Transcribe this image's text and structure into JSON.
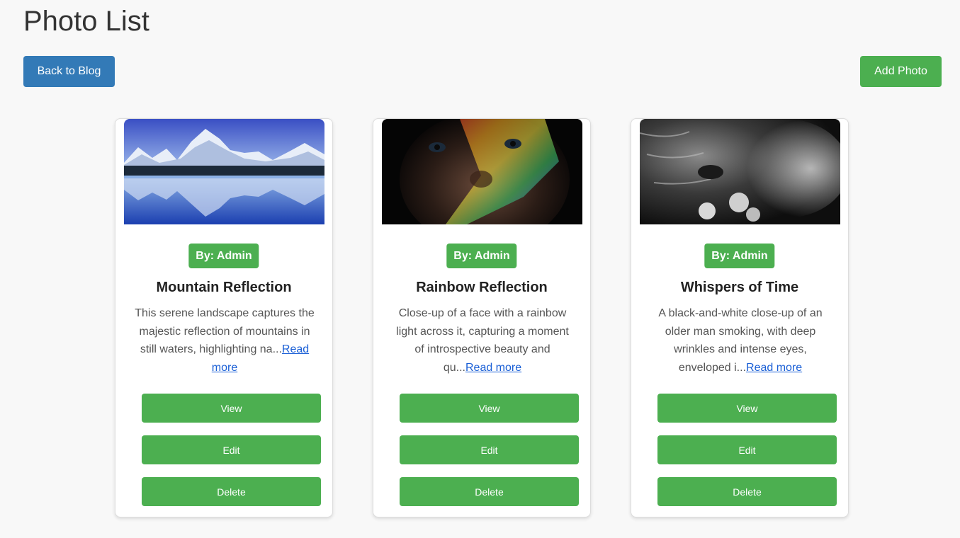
{
  "page": {
    "title": "Photo List",
    "back_button": "Back to Blog",
    "add_button": "Add Photo"
  },
  "colors": {
    "primary_blue": "#337ab7",
    "accent_green": "#4caf50",
    "link_blue": "#1a5fd6"
  },
  "photos": [
    {
      "author": "By: Admin",
      "title": "Mountain Reflection",
      "description": "This serene landscape captures the majestic reflection of mountains in still waters, highlighting na...",
      "read_more": "Read more",
      "view": "View",
      "edit": "Edit",
      "delete": "Delete"
    },
    {
      "author": "By: Admin",
      "title": "Rainbow Reflection",
      "description": "Close-up of a face with a rainbow light across it, capturing a moment of introspective beauty and qu...",
      "read_more": "Read more",
      "view": "View",
      "edit": "Edit",
      "delete": "Delete"
    },
    {
      "author": "By: Admin",
      "title": "Whispers of Time",
      "description": "A black-and-white close-up of an older man smoking, with deep wrinkles and intense eyes, enveloped i...",
      "read_more": "Read more",
      "view": "View",
      "edit": "Edit",
      "delete": "Delete"
    }
  ]
}
